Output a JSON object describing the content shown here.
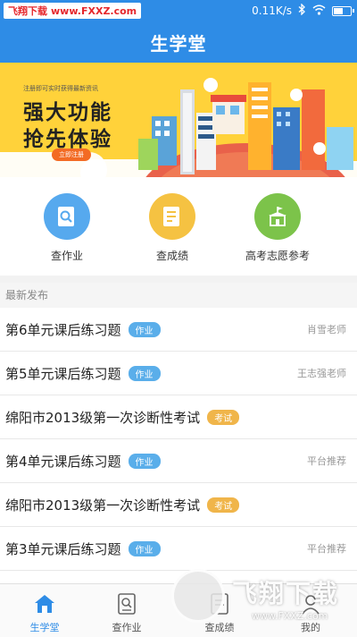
{
  "status_bar": {
    "watermark_left": "飞翔下载",
    "watermark_right": "www.FXXZ.com",
    "speed": "0.11K/s",
    "battery_level": 0.55
  },
  "header": {
    "title": "生学堂"
  },
  "banner": {
    "small_text": "注册即可实时获得最新资讯",
    "line1": "强大功能",
    "line2": "抢先体验",
    "button": "立即注册"
  },
  "quick_actions": [
    {
      "label": "查作业",
      "color": "#56a9ee",
      "icon": "search-document-icon"
    },
    {
      "label": "查成绩",
      "color": "#f5c242",
      "icon": "grade-report-icon"
    },
    {
      "label": "高考志愿参考",
      "color": "#7cc34a",
      "icon": "school-building-icon"
    }
  ],
  "section": {
    "title": "最新发布"
  },
  "list": [
    {
      "title": "第6单元课后练习题",
      "tag": "作业",
      "tag_type": "hw",
      "source": "肖雪老师"
    },
    {
      "title": "第5单元课后练习题",
      "tag": "作业",
      "tag_type": "hw",
      "source": "王志强老师"
    },
    {
      "title": "绵阳市2013级第一次诊断性考试",
      "tag": "考试",
      "tag_type": "ex",
      "source": ""
    },
    {
      "title": "第4单元课后练习题",
      "tag": "作业",
      "tag_type": "hw",
      "source": "平台推荐"
    },
    {
      "title": "绵阳市2013级第一次诊断性考试",
      "tag": "考试",
      "tag_type": "ex",
      "source": ""
    },
    {
      "title": "第3单元课后练习题",
      "tag": "作业",
      "tag_type": "hw",
      "source": "平台推荐"
    }
  ],
  "bottom_nav": [
    {
      "label": "生学堂",
      "active": true,
      "icon": "home-icon"
    },
    {
      "label": "查作业",
      "active": false,
      "icon": "homework-icon"
    },
    {
      "label": "查成绩",
      "active": false,
      "icon": "grades-icon"
    },
    {
      "label": "我的",
      "active": false,
      "icon": "profile-icon"
    }
  ],
  "watermark_bottom": {
    "big": "飞翔下载",
    "small": "www.FXXZ.com"
  },
  "colors": {
    "primary": "#2e8ce6",
    "banner": "#ffd23a",
    "tag_homework": "#5aaeea",
    "tag_exam": "#f0b54a"
  }
}
